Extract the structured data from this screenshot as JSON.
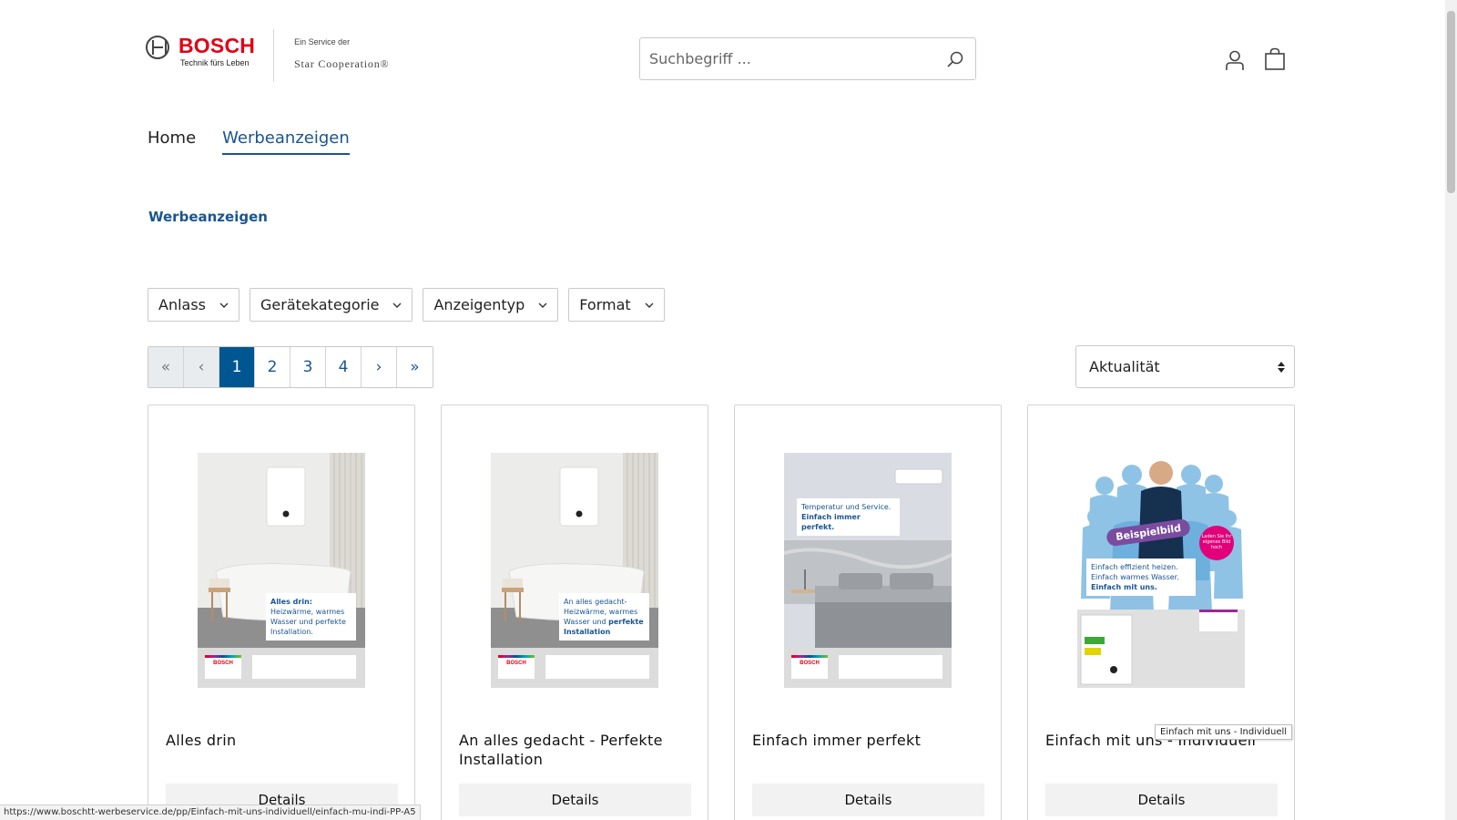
{
  "header": {
    "brand": "BOSCH",
    "brand_tagline": "Technik fürs Leben",
    "service_prefix": "Ein Service der",
    "service_name": "Star Cooperation®",
    "search_placeholder": "Suchbegriff ...",
    "icons": [
      "search-icon",
      "user-icon",
      "cart-icon"
    ]
  },
  "nav": {
    "items": [
      {
        "label": "Home",
        "active": false
      },
      {
        "label": "Werbeanzeigen",
        "active": true
      }
    ]
  },
  "page": {
    "title": "Werbeanzeigen"
  },
  "filters": [
    "Anlass",
    "Gerätekategorie",
    "Anzeigentyp",
    "Format"
  ],
  "pagination": {
    "first": "«",
    "prev": "‹",
    "pages": [
      "1",
      "2",
      "3",
      "4"
    ],
    "current": "1",
    "next": "›",
    "last": "»"
  },
  "sort": {
    "selected": "Aktualität"
  },
  "cards": [
    {
      "title": "Alles drin",
      "details_label": "Details",
      "ad_text_bold": "Alles drin:",
      "ad_text": "Heizwärme, warmes Wasser und perfekte Installation."
    },
    {
      "title": "An alles gedacht - Perfekte Installation",
      "details_label": "Details",
      "ad_text": "An alles gedacht- Heizwärme, warmes Wasser und",
      "ad_text_bold": "perfekte Installation"
    },
    {
      "title": "Einfach immer perfekt",
      "details_label": "Details",
      "ad_text": "Temperatur und Service.",
      "ad_text_bold": "Einfach immer perfekt."
    },
    {
      "title": "Einfach mit uns - Individuell",
      "details_label": "Details",
      "badge": "Beispielbild",
      "circle_text": "Laden Sie Ihr eigenes Bild hoch",
      "ad_text": "Einfach effizient heizen. Einfach warmes Wasser.",
      "ad_text_bold": "Einfach mit uns."
    }
  ],
  "tooltip": "Einfach mit uns - Individuell",
  "status_url": "https://www.boschtt-werbeservice.de/pp/Einfach-mit-uns-individuell/einfach-mu-indi-PP-A5",
  "colors": {
    "brand_red": "#e20015",
    "link_blue": "#1a5590",
    "active_page": "#005691"
  }
}
